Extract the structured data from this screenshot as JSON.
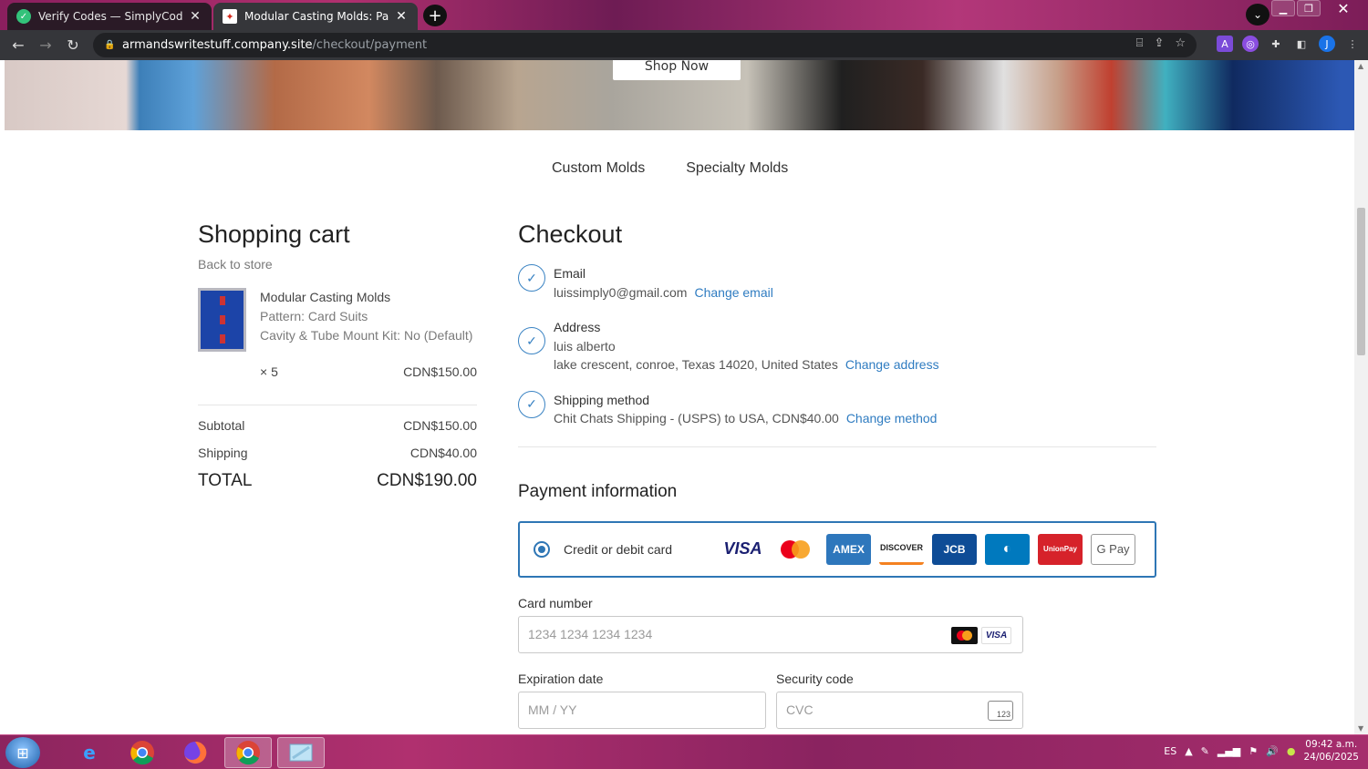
{
  "browser": {
    "tabs": [
      {
        "title": "Verify Codes — SimplyCodes",
        "close": "✕"
      },
      {
        "title": "Modular Casting Molds: Payment",
        "close": "✕"
      }
    ],
    "new_tab": "+",
    "url_host": "armandswritestuff.company.site",
    "url_path": "/checkout/payment",
    "profile_initial": "J"
  },
  "hero": {
    "shop_button": "Shop Now"
  },
  "subnav": {
    "items": [
      "Custom Molds",
      "Specialty Molds"
    ]
  },
  "cart": {
    "title": "Shopping cart",
    "back_link": "Back to store",
    "item": {
      "name": "Modular Casting Molds",
      "pattern": "Pattern: Card Suits",
      "kit": "Cavity & Tube Mount Kit: No (Default)",
      "qty": "× 5",
      "price": "CDN$150.00"
    },
    "subtotal_label": "Subtotal",
    "subtotal": "CDN$150.00",
    "shipping_label": "Shipping",
    "shipping": "CDN$40.00",
    "total_label": "TOTAL",
    "total": "CDN$190.00"
  },
  "checkout": {
    "title": "Checkout",
    "email": {
      "label": "Email",
      "value": "luissimply0@gmail.com",
      "link": "Change email"
    },
    "address": {
      "label": "Address",
      "name": "luis alberto",
      "line": "lake crescent, conroe, Texas 14020, United States",
      "link": "Change address"
    },
    "shipping": {
      "label": "Shipping method",
      "value": "Chit Chats Shipping - (USPS) to USA, CDN$40.00",
      "link": "Change method"
    },
    "payment_title": "Payment information",
    "payment_method": "Credit or debit card",
    "brands": [
      "VISA",
      "mastercard",
      "AMEX",
      "DISCOVER",
      "JCB",
      "Diners",
      "UnionPay",
      "G Pay"
    ],
    "card_number_label": "Card number",
    "card_number_placeholder": "1234 1234 1234 1234",
    "expiry_label": "Expiration date",
    "expiry_placeholder": "MM / YY",
    "cvc_label": "Security code",
    "cvc_placeholder": "CVC",
    "cvc_icon_text": "123"
  },
  "taskbar": {
    "lang": "ES",
    "time": "09:42 a.m.",
    "date": "24/06/2025"
  },
  "colors": {
    "accent": "#2e76b5",
    "link": "#2f7cc1"
  }
}
